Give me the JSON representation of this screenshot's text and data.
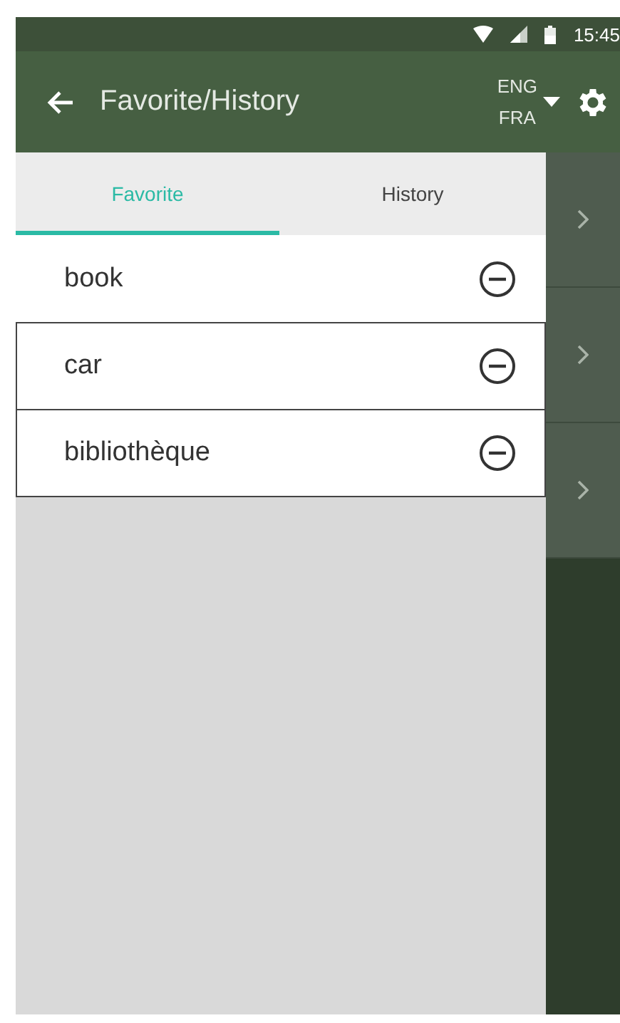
{
  "status_bar": {
    "time": "15:45"
  },
  "app_bar": {
    "title": "Favorite/History",
    "languages": [
      "ENG",
      "FRA"
    ]
  },
  "tabs": [
    {
      "label": "Favorite",
      "selected": true
    },
    {
      "label": "History",
      "selected": false
    }
  ],
  "items": [
    {
      "word": "book",
      "outlined": false
    },
    {
      "word": "car",
      "outlined": true
    },
    {
      "word": "bibliothèque",
      "outlined": true
    }
  ]
}
